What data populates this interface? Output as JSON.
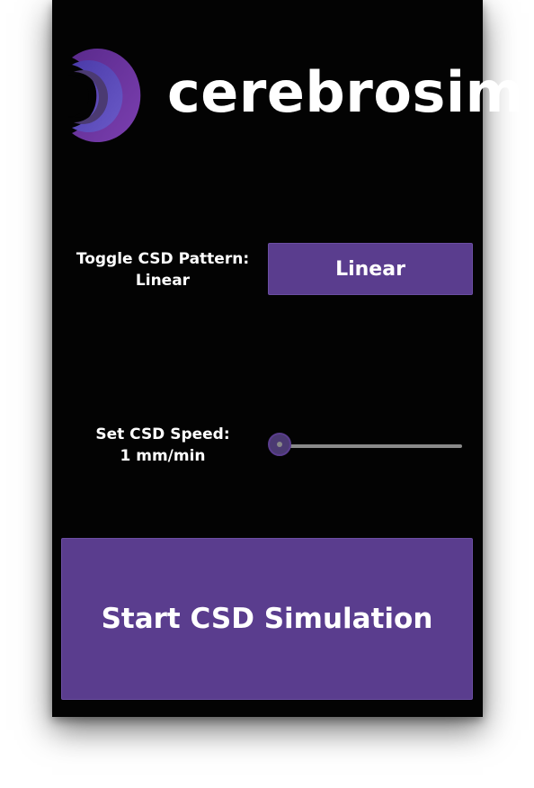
{
  "app": {
    "logo_text": "cerebrosim",
    "brand_color": "#5a3d8e"
  },
  "pattern": {
    "label_line1": "Toggle CSD Pattern:",
    "label_line2": "Linear",
    "button_label": "Linear"
  },
  "speed": {
    "label_line1": "Set CSD Speed:",
    "label_line2": "1 mm/min",
    "slider_value_fraction": 0
  },
  "actions": {
    "start_label": "Start CSD Simulation"
  }
}
